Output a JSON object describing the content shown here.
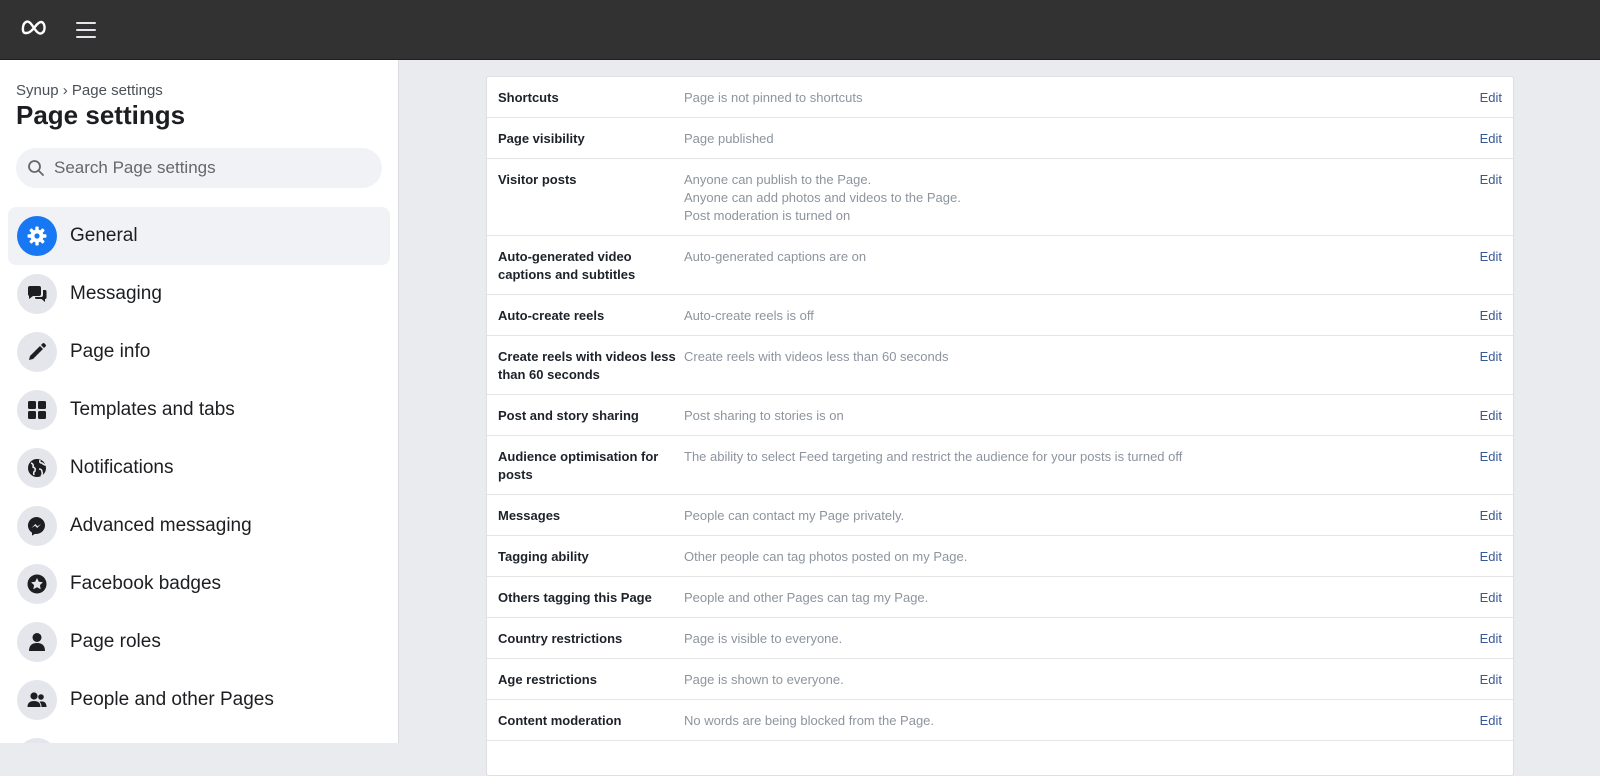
{
  "header": {
    "logo_icon": "meta-logo-icon",
    "menu_icon": "hamburger-menu-icon"
  },
  "sidebar": {
    "breadcrumb": {
      "parent": "Synup",
      "separator": " › ",
      "current": "Page settings"
    },
    "title": "Page settings",
    "search": {
      "placeholder": "Search Page settings",
      "value": ""
    },
    "active_color": "#1877f2",
    "items": [
      {
        "label": "General",
        "icon": "gear-icon",
        "active": true
      },
      {
        "label": "Messaging",
        "icon": "chat-bubbles-icon",
        "active": false
      },
      {
        "label": "Page info",
        "icon": "pencil-icon",
        "active": false
      },
      {
        "label": "Templates and tabs",
        "icon": "grid-icon",
        "active": false
      },
      {
        "label": "Notifications",
        "icon": "globe-icon",
        "active": false
      },
      {
        "label": "Advanced messaging",
        "icon": "messenger-icon",
        "active": false
      },
      {
        "label": "Facebook badges",
        "icon": "star-badge-icon",
        "active": false
      },
      {
        "label": "Page roles",
        "icon": "person-icon",
        "active": false
      },
      {
        "label": "People and other Pages",
        "icon": "people-icon",
        "active": false
      }
    ]
  },
  "settings": {
    "edit_label": "Edit",
    "rows": [
      {
        "label": "Shortcuts",
        "value": "Page is not pinned to shortcuts"
      },
      {
        "label": "Page visibility",
        "value": "Page published"
      },
      {
        "label": "Visitor posts",
        "value": "Anyone can publish to the Page.\nAnyone can add photos and videos to the Page.\nPost moderation is turned on"
      },
      {
        "label": "Auto-generated video captions and subtitles",
        "value": "Auto-generated captions are on"
      },
      {
        "label": "Auto-create reels",
        "value": "Auto-create reels is off"
      },
      {
        "label": "Create reels with videos less than 60 seconds",
        "value": "Create reels with videos less than 60 seconds"
      },
      {
        "label": "Post and story sharing",
        "value": "Post sharing to stories is on"
      },
      {
        "label": "Audience optimisation for posts",
        "value": "The ability to select Feed targeting and restrict the audience for your posts is turned off"
      },
      {
        "label": "Messages",
        "value": "People can contact my Page privately."
      },
      {
        "label": "Tagging ability",
        "value": "Other people can tag photos posted on my Page."
      },
      {
        "label": "Others tagging this Page",
        "value": "People and other Pages can tag my Page."
      },
      {
        "label": "Country restrictions",
        "value": "Page is visible to everyone."
      },
      {
        "label": "Age restrictions",
        "value": "Page is shown to everyone."
      },
      {
        "label": "Content moderation",
        "value": "No words are being blocked from the Page."
      }
    ]
  }
}
